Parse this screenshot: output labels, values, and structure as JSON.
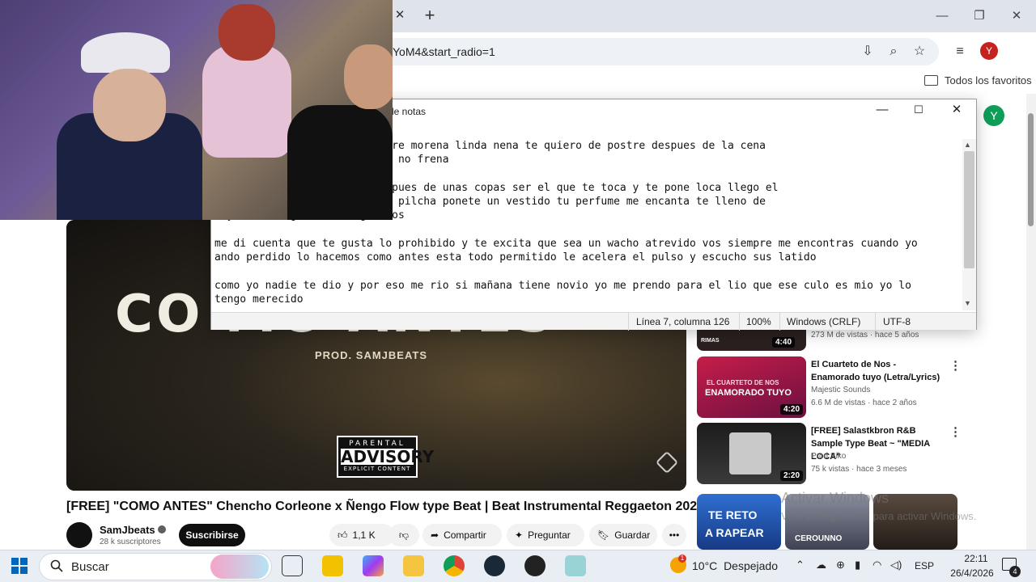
{
  "browser": {
    "url": "YoM4&start_radio=1",
    "bookmarks_all": "Todos los favoritos",
    "profile_initial": "Y"
  },
  "youtube": {
    "avatar_initial": "Y",
    "video": {
      "title": "[FREE] \"COMO ANTES\" Chencho Corleone x Ñengo Flow type Beat | Beat Instrumental Reggaeton 2026",
      "thumb_text": "CO  MO ANTES",
      "prod": "PROD. SAMJBEATS",
      "advisory_top": "PARENTAL",
      "advisory_mid": "ADVISORY",
      "advisory_bottom": "EXPLICIT CONTENT"
    },
    "channel": {
      "name": "SamJbeats",
      "subs": "28 k suscriptores",
      "subscribe": "Suscribirse"
    },
    "actions": {
      "likes": "1,1 K",
      "share": "Compartir",
      "ask": "Preguntar",
      "save": "Guardar"
    },
    "recommendations": [
      {
        "meta": "273 M de vistas · hace 5 años",
        "duration": "4:40",
        "thumb_label": "RIMAS"
      },
      {
        "title": "El Cuarteto de Nos - Enamorado tuyo (Letra/Lyrics)",
        "channel": "Majestic Sounds",
        "meta": "6.6 M de vistas · hace 2 años",
        "duration": "4:20",
        "thumb_line1": "EL CUARTETO DE NOS",
        "thumb_line2": "ENAMORADO TUYO"
      },
      {
        "title": "[FREE] Salastkbron R&B Sample Type Beat ~ \"MEDIA LOCA\"",
        "channel": "Prod Siko",
        "meta": "75 k vistas · hace 3 meses",
        "duration": "2:20"
      }
    ],
    "shorts": {
      "s1_line1": "TE RETO",
      "s1_line2": "A RAPEAR",
      "s2_label": "CEROUNNO"
    },
    "watermark_line1": "Activar Windows",
    "watermark_line2": "Ve a Configuración para activar Windows."
  },
  "notepad": {
    "title": "de notas",
    "lines": [
      "  lo dare aunque no te enamore morena linda nena te quiero de postre despues de la cena",
      "  adena y que cuando arranca no frena",
      "",
      "  ropa llenarte de besos despues de unas copas ser el que te toca y te pone loca llego el",
      "  a los dolidos te compro tu pilcha ponete un vestido tu perfume me encanta te lleno de",
      "  y flaca regalame tus gemidos",
      "",
      "me di cuenta que te gusta lo prohibido y te excita que sea un wacho atrevido vos siempre me encontras cuando yo",
      "ando perdido lo hacemos como antes esta todo permitido le acelera el pulso y escucho sus latido",
      "",
      "como yo nadie te dio y por eso me rio si mañana tiene novio yo me prendo para el lio que ese culo es mio yo lo",
      "tengo merecido"
    ],
    "status": {
      "position": "Línea 7, columna 126",
      "zoom": "100%",
      "line_endings": "Windows (CRLF)",
      "encoding": "UTF-8"
    }
  },
  "taskbar": {
    "search_placeholder": "Buscar",
    "weather_temp": "10°C",
    "weather_desc": "Despejado",
    "weather_badge": "1",
    "language": "ESP",
    "time": "22:11",
    "date": "26/4/2026",
    "notifications": "4"
  },
  "colors": {
    "youtube_red": "#ff0000",
    "subscribe_bg": "#0f0f0f",
    "taskbar_bg": "#e9eef4",
    "chrome_tabbar": "#dfe3eb"
  }
}
